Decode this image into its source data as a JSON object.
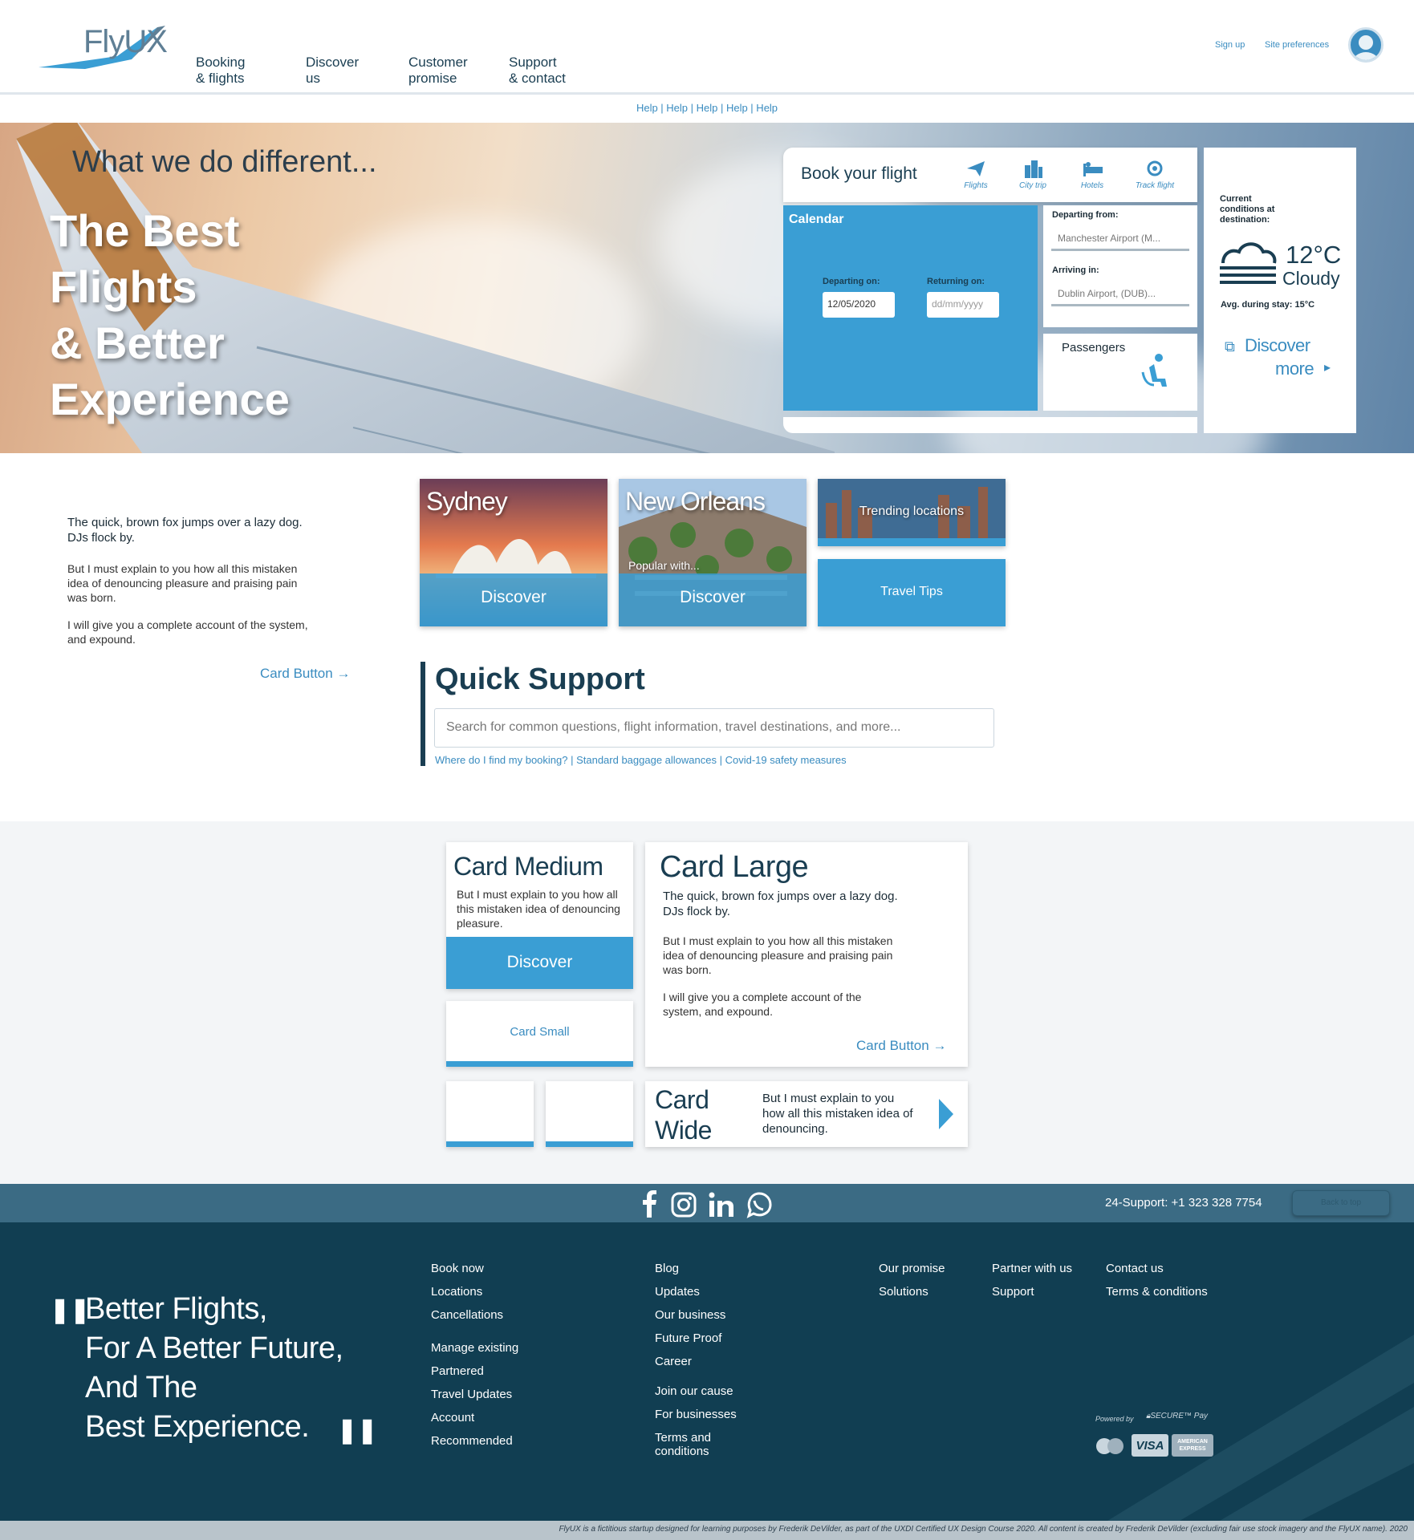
{
  "brand": {
    "logo": "FlyUX",
    "accent": "#3a9ed4",
    "dark": "#113e52"
  },
  "nav": {
    "items": [
      "Booking\n& flights",
      "Discover\nus",
      "Customer\npromise",
      "Support\n& contact"
    ],
    "signup": "Sign up",
    "prefs": "Site preferences"
  },
  "help_links": "Help | Help | Help | Help | Help",
  "hero": {
    "subtitle": "What we do different...",
    "title": "The Best\nFlights\n& Better\nExperience"
  },
  "booking": {
    "title": "Book your flight",
    "tabs": [
      {
        "label": "Flights",
        "icon": "plane-icon"
      },
      {
        "label": "City trip",
        "icon": "city-icon"
      },
      {
        "label": "Hotels",
        "icon": "bed-icon"
      },
      {
        "label": "Track flight",
        "icon": "target-icon"
      }
    ],
    "calendar_label": "Calendar",
    "departing_on_label": "Departing on:",
    "departing_on_value": "12/05/2020",
    "returning_on_label": "Returning on:",
    "returning_on_placeholder": "dd/mm/yyyy",
    "departing_from_label": "Departing from:",
    "departing_from_value": "Manchester Airport (M...",
    "arriving_in_label": "Arriving in:",
    "arriving_in_value": "Dublin Airport, (DUB)...",
    "passengers_label": "Passengers"
  },
  "weather": {
    "heading": "Current conditions at destination:",
    "temp": "12°C",
    "condition": "Cloudy",
    "avg": "Avg. during stay: 15°C",
    "discover": "Discover",
    "more": "more"
  },
  "intro": {
    "bold": "The quick, brown fox jumps over a lazy dog. DJs flock by.",
    "p1": "But I must explain to you how all this mistaken idea of denouncing pleasure and praising pain was born.",
    "p2": "I will give you a complete account of the system, and expound.",
    "button": "Card Button →"
  },
  "destinations": [
    {
      "name": "Sydney",
      "action": "Discover"
    },
    {
      "name": "New Orleans",
      "tag": "Popular with...",
      "action": "Discover"
    },
    {
      "name": "Trending locations"
    },
    {
      "name": "Travel Tips"
    }
  ],
  "quick_support": {
    "title": "Quick Support",
    "placeholder": "Search for common questions, flight information, travel destinations, and more...",
    "links": "Where do I find my booking? | Standard baggage allowances | Covid-19 safety measures"
  },
  "cards": {
    "medium_title": "Card Medium",
    "medium_text": "But I must explain to you how all this mistaken idea of denouncing pleasure.",
    "medium_button": "Discover",
    "small_title": "Card Small",
    "large_title": "Card Large",
    "large_bold": "The quick, brown fox jumps over a lazy dog. DJs flock by.",
    "large_p1": "But I must explain to you how all this mistaken idea of denouncing pleasure and praising pain was born.",
    "large_p2": "I will give you a complete account of the system, and expound.",
    "large_button": "Card Button →",
    "wide_title": "Card\nWide",
    "wide_text": "But I must explain to you how all this mistaken idea of denouncing."
  },
  "footer": {
    "social": [
      "facebook-icon",
      "instagram-icon",
      "linkedin-icon",
      "whatsapp-icon"
    ],
    "support": "24-Support: +1 323 328 7754",
    "back_to_top": "Back to top",
    "quote": "Better Flights,\nFor A Better Future,\nAnd The\nBest Experience.",
    "col1a": [
      "Book now",
      "Locations",
      "Cancellations"
    ],
    "col1b": [
      "Manage existing",
      "Partnered",
      "Travel Updates",
      "Account",
      "Recommended"
    ],
    "col2a": [
      "Blog",
      "Updates",
      "Our business",
      "Future Proof",
      "Career"
    ],
    "col2b": [
      "Join our cause",
      "For businesses",
      "Terms and\nconditions"
    ],
    "col3": [
      "Our promise",
      "Solutions"
    ],
    "col4": [
      "Partner with us",
      "Support"
    ],
    "col5": [
      "Contact us",
      "Terms & conditions"
    ],
    "powered_by": "Powered by",
    "secure_pay": "SECURE™ Pay",
    "payment": [
      "mastercard-icon",
      "VISA",
      "AMERICAN EXPRESS"
    ],
    "legal": "FlyUX is a fictitious startup designed for learning purposes by Frederik DeVilder, as part of the UXDI Certified UX Design Course 2020. All content is created by Frederik DeVilder (excluding fair use stock imagery and the FlyUX name). 2020"
  }
}
